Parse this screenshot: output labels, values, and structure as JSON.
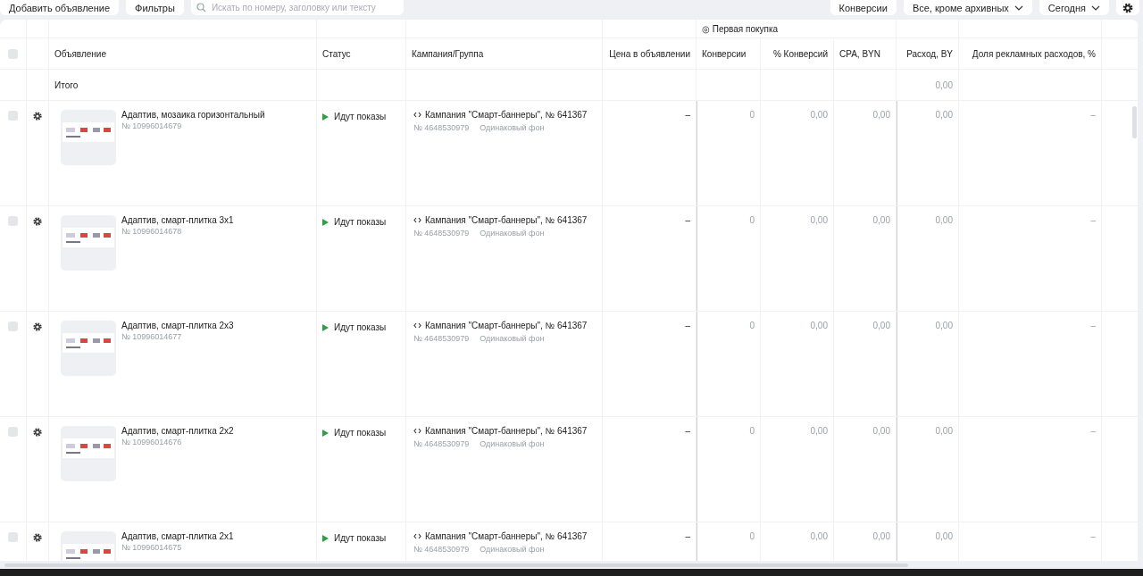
{
  "toolbar": {
    "add_button": "Добавить объявление",
    "filters_button": "Фильтры",
    "search": {
      "placeholder": "Искать по номеру, заголовку или тексту"
    },
    "conversions_button": "Конверсии",
    "archive_select": "Все, кроме архивных",
    "period_select": "Сегодня"
  },
  "table": {
    "goal_header": "◎ Первая покупка",
    "select_all": {
      "checked": false
    },
    "columns": [
      "Объявление",
      "Статус",
      "Кампания/Группа",
      "Цена в объявлении",
      "Конверсии",
      "% Конверсий",
      "CPA, BYN",
      "Расход, BY",
      "Доля рекламных расходов, %"
    ],
    "total": {
      "label": "Итого",
      "spend": "0,00"
    },
    "rows": [
      {
        "checked": false,
        "title": "Адаптив, мозаика горизонтальный",
        "id": "№ 10996014679",
        "status": "Идут показы",
        "campaign": "Кампания \"Смарт-баннеры\", № 641367",
        "group_id": "№ 4648530979",
        "group_name": "Одинаковый фон",
        "price": "–",
        "conversions": "0",
        "conv_rate": "0,00",
        "cpa": "0,00",
        "spend": "0,00",
        "share": "–"
      },
      {
        "checked": false,
        "title": "Адаптив, смарт-плитка 3x1",
        "id": "№ 10996014678",
        "status": "Идут показы",
        "campaign": "Кампания \"Смарт-баннеры\", № 641367",
        "group_id": "№ 4648530979",
        "group_name": "Одинаковый фон",
        "price": "–",
        "conversions": "0",
        "conv_rate": "0,00",
        "cpa": "0,00",
        "spend": "0,00",
        "share": "–"
      },
      {
        "checked": false,
        "title": "Адаптив, смарт-плитка 2x3",
        "id": "№ 10996014677",
        "status": "Идут показы",
        "campaign": "Кампания \"Смарт-баннеры\", № 641367",
        "group_id": "№ 4648530979",
        "group_name": "Одинаковый фон",
        "price": "–",
        "conversions": "0",
        "conv_rate": "0,00",
        "cpa": "0,00",
        "spend": "0,00",
        "share": "–"
      },
      {
        "checked": false,
        "title": "Адаптив, смарт-плитка 2x2",
        "id": "№ 10996014676",
        "status": "Идут показы",
        "campaign": "Кампания \"Смарт-баннеры\", № 641367",
        "group_id": "№ 4648530979",
        "group_name": "Одинаковый фон",
        "price": "–",
        "conversions": "0",
        "conv_rate": "0,00",
        "cpa": "0,00",
        "spend": "0,00",
        "share": "–"
      },
      {
        "checked": false,
        "title": "Адаптив, смарт-плитка 2x1",
        "id": "№ 10996014675",
        "status": "Идут показы",
        "campaign": "Кампания \"Смарт-баннеры\", № 641367",
        "group_id": "№ 4648530979",
        "group_name": "Одинаковый фон",
        "price": "–",
        "conversions": "0",
        "conv_rate": "0,00",
        "cpa": "0,00",
        "spend": "0,00",
        "share": "–"
      }
    ]
  }
}
